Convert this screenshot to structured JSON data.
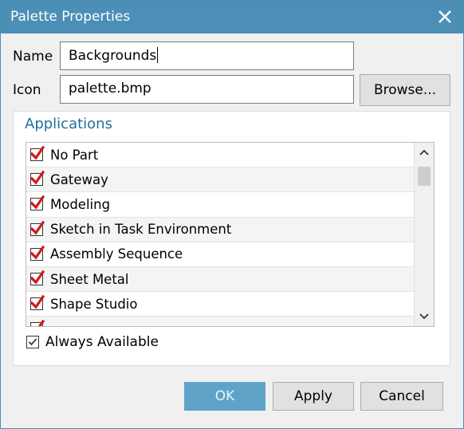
{
  "dialog": {
    "title": "Palette Properties",
    "name_label": "Name",
    "name_value": "Backgrounds",
    "icon_label": "Icon",
    "icon_value": "palette.bmp",
    "browse_label": "Browse...",
    "applications": {
      "title": "Applications",
      "items": [
        {
          "label": "No Part",
          "checked": true
        },
        {
          "label": "Gateway",
          "checked": true
        },
        {
          "label": "Modeling",
          "checked": true
        },
        {
          "label": "Sketch in Task Environment",
          "checked": true
        },
        {
          "label": "Assembly Sequence",
          "checked": true
        },
        {
          "label": "Sheet Metal",
          "checked": true
        },
        {
          "label": "Shape Studio",
          "checked": true
        },
        {
          "label": "",
          "checked": true
        }
      ],
      "always_available_label": "Always Available",
      "always_available_checked": true
    },
    "buttons": {
      "ok": "OK",
      "apply": "Apply",
      "cancel": "Cancel"
    }
  },
  "colors": {
    "titlebar": "#4b8fb6",
    "accent_title": "#1f6e9e",
    "ok_button": "#5fa3c8",
    "check_red": "#cc1b1b"
  },
  "icons": {
    "close": "close-icon",
    "check": "checkmark-icon",
    "scroll_up": "chevron-up-icon",
    "scroll_down": "chevron-down-icon"
  }
}
